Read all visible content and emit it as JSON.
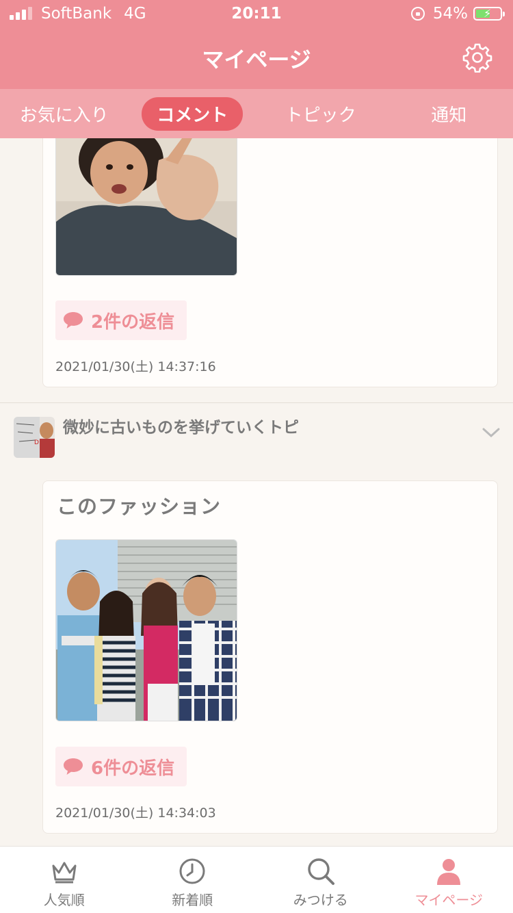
{
  "status_bar": {
    "carrier": "SoftBank",
    "network": "4G",
    "time": "20:11",
    "battery": "54%",
    "battery_level": 0.54
  },
  "header": {
    "title": "マイページ",
    "settings_icon": "gear-icon"
  },
  "tabs": [
    {
      "label": "お気に入り",
      "active": false
    },
    {
      "label": "コメント",
      "active": true
    },
    {
      "label": "トピック",
      "active": false
    },
    {
      "label": "通知",
      "active": false
    }
  ],
  "comments": [
    {
      "reply_label": "2件の返信",
      "date": "2021/01/30(土) 14:37:16"
    },
    {
      "topic_title": "微妙に古いものを挙げていくトピ",
      "text": "このファッション",
      "reply_label": "6件の返信",
      "date": "2021/01/30(土) 14:34:03"
    }
  ],
  "bottom_nav": [
    {
      "label": "人気順",
      "icon": "crown-icon",
      "active": false
    },
    {
      "label": "新着順",
      "icon": "clock-icon",
      "active": false
    },
    {
      "label": "みつける",
      "icon": "search-icon",
      "active": false
    },
    {
      "label": "マイページ",
      "icon": "person-icon",
      "active": true
    }
  ],
  "colors": {
    "accent": "#ee8e96",
    "tab_bar": "#f2a6ac",
    "active_tab": "#e96069",
    "reply_bg": "#fdeef0"
  }
}
